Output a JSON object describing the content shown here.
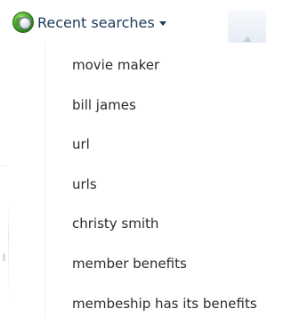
{
  "header": {
    "title": "Recent searches",
    "icon": "globe-search-icon",
    "caret_icon": "caret-down-icon"
  },
  "recent_searches": [
    "movie maker",
    "bill james",
    "url",
    "urls",
    "christy smith",
    "member benefits",
    "membeship has its benefits"
  ],
  "colors": {
    "header_text": "#1e395b",
    "item_text": "#2b2b2b",
    "background": "#ffffff"
  }
}
